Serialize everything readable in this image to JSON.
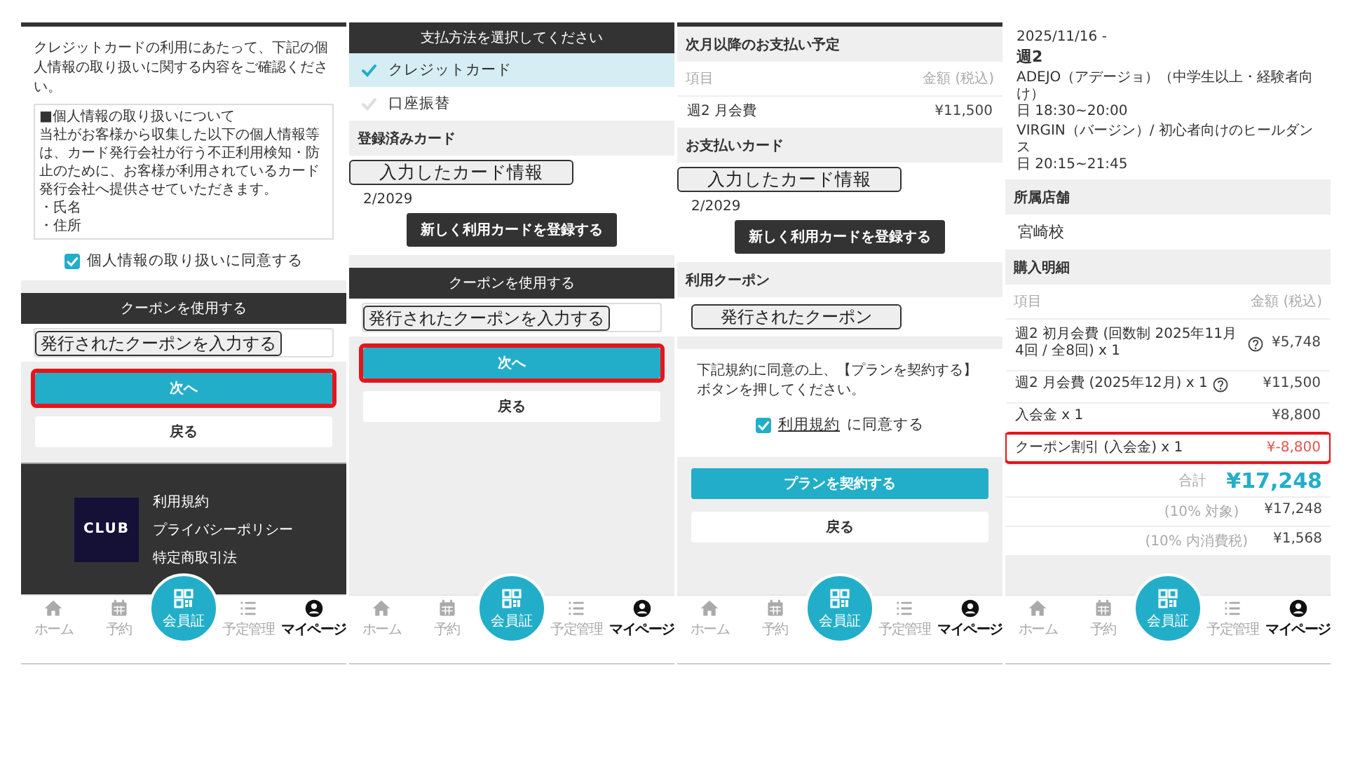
{
  "panels": [
    {
      "blocks": [
        {
          "kind": "topbar"
        },
        {
          "kind": "paragraph",
          "text": "クレジットカードの利用にあたって、下記の個人情報の取り扱いに関する内容をご確認ください。"
        },
        {
          "kind": "notice",
          "lines": [
            "■個人情報の取り扱いについて",
            "当社がお客様から収集した以下の個人情報等は、カード発行会社が行う不正利用検知・防止のために、お客様が利用されているカード発行会社へ提供させていただきます。",
            "・氏名",
            "・住所"
          ]
        },
        {
          "kind": "checkbox",
          "label": "個人情報の取り扱いに同意する",
          "checked": true
        },
        {
          "kind": "gap"
        },
        {
          "kind": "dark_header",
          "text": "クーポンを使用する"
        },
        {
          "kind": "coupon_field",
          "value": "発行されたクーポンを入力する"
        },
        {
          "kind": "actions",
          "buttons": [
            {
              "label": "次へ",
              "highlighted": true
            },
            {
              "label": "戻る",
              "highlighted": false
            }
          ]
        },
        {
          "kind": "footer",
          "logo": "CLUB",
          "links": [
            "利用規約",
            "プライバシーポリシー",
            "特定商取引法"
          ]
        }
      ],
      "nav": [
        {
          "label": "ホーム",
          "selected": false
        },
        {
          "label": "予約",
          "selected": false
        },
        {
          "label": "会員証",
          "selected": false
        },
        {
          "label": "予定管理",
          "selected": false
        },
        {
          "label": "マイページ",
          "selected": true
        }
      ]
    },
    {
      "blocks": [
        {
          "kind": "dark_header",
          "text": "支払方法を選択してください"
        },
        {
          "kind": "options",
          "items": [
            {
              "label": "クレジットカード",
              "selected": true
            },
            {
              "label": "口座振替",
              "selected": false
            }
          ]
        },
        {
          "kind": "section_header",
          "text": "登録済みカード"
        },
        {
          "kind": "card_info",
          "label": "入力したカード情報",
          "expiry": "2/2029",
          "button": "新しく利用カードを登録する"
        },
        {
          "kind": "gap"
        },
        {
          "kind": "dark_header",
          "text": "クーポンを使用する"
        },
        {
          "kind": "coupon_field",
          "value": "発行されたクーポンを入力する"
        },
        {
          "kind": "actions",
          "buttons": [
            {
              "label": "次へ",
              "highlighted": true
            },
            {
              "label": "戻る",
              "highlighted": false
            }
          ]
        }
      ],
      "nav": [
        {
          "label": "ホーム",
          "selected": false
        },
        {
          "label": "予約",
          "selected": false
        },
        {
          "label": "会員証",
          "selected": false
        },
        {
          "label": "予定管理",
          "selected": false
        },
        {
          "label": "マイページ",
          "selected": true
        }
      ]
    },
    {
      "blocks": [
        {
          "kind": "topbar"
        },
        {
          "kind": "section_header",
          "text": "次月以降のお支払い予定"
        },
        {
          "kind": "table",
          "columns": [
            "項目",
            "金額 (税込)"
          ],
          "rows": [
            {
              "item": "週2 月会費",
              "amount": "¥11,500",
              "help": false,
              "negative": false,
              "highlighted": false
            }
          ]
        },
        {
          "kind": "section_header",
          "text": "お支払いカード"
        },
        {
          "kind": "card_info",
          "label": "入力したカード情報",
          "expiry": "2/2029",
          "button": "新しく利用カードを登録する"
        },
        {
          "kind": "section_header",
          "text": "利用クーポン"
        },
        {
          "kind": "coupon_note",
          "value": "発行されたクーポン"
        },
        {
          "kind": "gap"
        },
        {
          "kind": "agreement",
          "text": "下記規約に同意の上、【プランを契約する】ボタンを押してください。",
          "link": "利用規約",
          "label": "に同意する",
          "checked": true
        },
        {
          "kind": "actions",
          "buttons": [
            {
              "label": "プランを契約する",
              "highlighted": false
            },
            {
              "label": "戻る",
              "highlighted": false
            }
          ]
        }
      ],
      "nav": [
        {
          "label": "ホーム",
          "selected": false
        },
        {
          "label": "予約",
          "selected": false
        },
        {
          "label": "会員証",
          "selected": false
        },
        {
          "label": "予定管理",
          "selected": false
        },
        {
          "label": "マイページ",
          "selected": true
        }
      ]
    },
    {
      "blocks": [
        {
          "kind": "schedule",
          "date": "2025/11/16 -",
          "plan": "週2",
          "classes": [
            {
              "name": "ADEJO（アデージョ）（中学生以上・経験者向け）",
              "time": "日 18:30~20:00"
            },
            {
              "name": "VIRGIN（バージン）/ 初心者向けのヒールダンス",
              "time": "日 20:15~21:45"
            }
          ]
        },
        {
          "kind": "section_header",
          "text": "所属店舗"
        },
        {
          "kind": "plain",
          "text": "宮崎校"
        },
        {
          "kind": "section_header",
          "text": "購入明細"
        },
        {
          "kind": "table",
          "columns": [
            "項目",
            "金額 (税込)"
          ],
          "rows": [
            {
              "item": "週2 初月会費 (回数制 2025年11月 4回 / 全8回) x 1",
              "amount": "¥5,748",
              "help": true,
              "negative": false,
              "highlighted": false
            },
            {
              "item": "週2 月会費 (2025年12月) x 1",
              "amount": "¥11,500",
              "help": true,
              "negative": false,
              "highlighted": false
            },
            {
              "item": "入会金 x 1",
              "amount": "¥8,800",
              "help": false,
              "negative": false,
              "highlighted": false
            },
            {
              "item": "クーポン割引 (入会金) x 1",
              "amount": "¥-8,800",
              "help": false,
              "negative": true,
              "highlighted": true
            }
          ]
        },
        {
          "kind": "total",
          "label": "合計",
          "amount": "¥17,248"
        },
        {
          "kind": "summary",
          "rows": [
            {
              "label": "(10% 対象)",
              "amount": "¥17,248"
            },
            {
              "label": "(10% 内消費税)",
              "amount": "¥1,568"
            }
          ]
        },
        {
          "kind": "gap"
        }
      ],
      "nav": [
        {
          "label": "ホーム",
          "selected": false
        },
        {
          "label": "予約",
          "selected": false
        },
        {
          "label": "会員証",
          "selected": false
        },
        {
          "label": "予定管理",
          "selected": false
        },
        {
          "label": "マイページ",
          "selected": true
        }
      ]
    }
  ]
}
